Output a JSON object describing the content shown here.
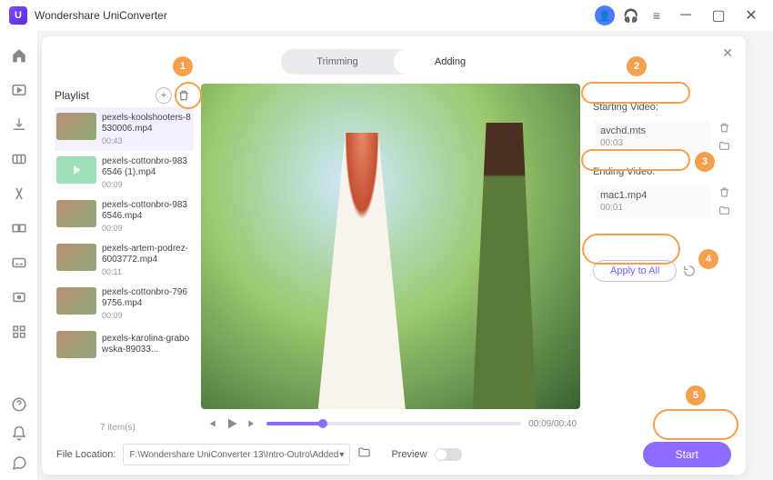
{
  "app": {
    "title": "Wondershare UniConverter"
  },
  "segments": {
    "trimming": "Trimming",
    "adding": "Adding"
  },
  "playlist": {
    "title": "Playlist",
    "items": [
      {
        "name": "pexels-koolshooters-8530006.mp4",
        "dur": "00:43"
      },
      {
        "name": "pexels-cottonbro-9836546 (1).mp4",
        "dur": "00:09"
      },
      {
        "name": "pexels-cottonbro-9836546.mp4",
        "dur": "00:09"
      },
      {
        "name": "pexels-artem-podrez-6003772.mp4",
        "dur": "00:11"
      },
      {
        "name": "pexels-cottonbro-7969756.mp4",
        "dur": "00:09"
      },
      {
        "name": "pexels-karolina-grabowska-89033...",
        "dur": ""
      }
    ],
    "count": "7 item(s)"
  },
  "player": {
    "time": "00:09/00:40"
  },
  "right": {
    "starting_label": "Starting Video:",
    "starting": {
      "name": "avchd.mts",
      "dur": "00:03"
    },
    "ending_label": "Ending Video:",
    "ending": {
      "name": "mac1.mp4",
      "dur": "00:01"
    },
    "apply": "Apply to All"
  },
  "footer": {
    "location_label": "File Location:",
    "location_value": "F:\\Wondershare UniConverter 13\\Intro-Outro\\Added",
    "preview_label": "Preview",
    "start": "Start"
  },
  "callouts": {
    "c1": "1",
    "c2": "2",
    "c3": "3",
    "c4": "4",
    "c5": "5"
  }
}
